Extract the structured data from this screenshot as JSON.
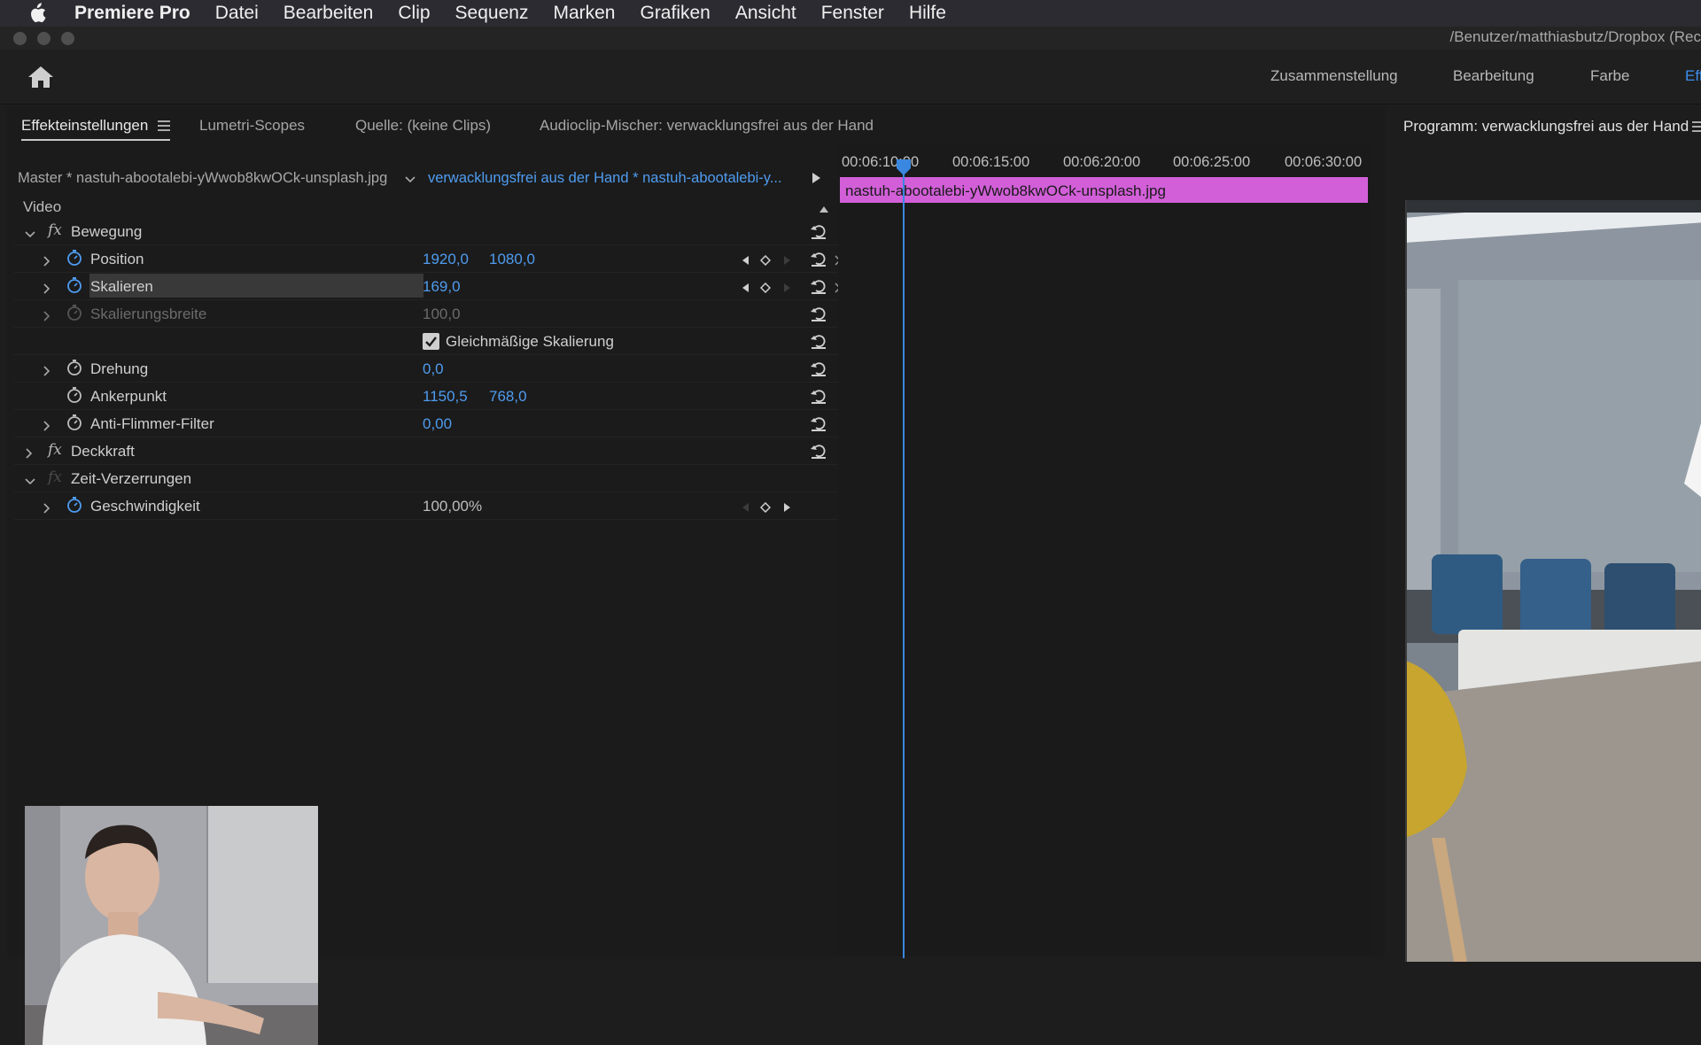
{
  "menubar": {
    "app": "Premiere Pro",
    "items": [
      "Datei",
      "Bearbeiten",
      "Clip",
      "Sequenz",
      "Marken",
      "Grafiken",
      "Ansicht",
      "Fenster",
      "Hilfe"
    ]
  },
  "titlebar": {
    "path": "/Benutzer/matthiasbutz/Dropbox (Rec"
  },
  "workspaces": {
    "items": [
      "Zusammenstellung",
      "Bearbeitung",
      "Farbe",
      "Eff"
    ],
    "active": "Eff"
  },
  "tabs": {
    "effekteinstellungen": "Effekteinstellungen",
    "lumetri": "Lumetri-Scopes",
    "quelle": "Quelle: (keine Clips)",
    "audiomixer": "Audioclip-Mischer: verwacklungsfrei aus der Hand"
  },
  "source": {
    "master": "Master * nastuh-abootalebi-yWwob8kwOCk-unsplash.jpg",
    "sequence_clip": "verwacklungsfrei aus der Hand * nastuh-abootalebi-y..."
  },
  "effects": {
    "video_label": "Video",
    "bewegung": "Bewegung",
    "position": {
      "name": "Position",
      "x": "1920,0",
      "y": "1080,0"
    },
    "skalieren": {
      "name": "Skalieren",
      "value": "169,0"
    },
    "skalierungsbreite": {
      "name": "Skalierungsbreite",
      "value": "100,0"
    },
    "gleichmaessig": {
      "label": "Gleichmäßige Skalierung",
      "checked": true
    },
    "drehung": {
      "name": "Drehung",
      "value": "0,0"
    },
    "ankerpunkt": {
      "name": "Ankerpunkt",
      "x": "1150,5",
      "y": "768,0"
    },
    "antiflimmer": {
      "name": "Anti-Flimmer-Filter",
      "value": "0,00"
    },
    "deckkraft": "Deckkraft",
    "zeitverzerrungen": "Zeit-Verzerrungen",
    "geschwindigkeit": {
      "name": "Geschwindigkeit",
      "value": "100,00%"
    }
  },
  "timeline": {
    "ticks": [
      "00:06:10:00",
      "00:06:15:00",
      "00:06:20:00",
      "00:06:25:00",
      "00:06:30:00"
    ],
    "clip_name": "nastuh-abootalebi-yWwob8kwOCk-unsplash.jpg"
  },
  "program": {
    "title": "Programm: verwacklungsfrei aus der Hand"
  },
  "colors": {
    "accent": "#4f9cf0",
    "clip": "#d25fd8",
    "playhead": "#3a87e0"
  }
}
